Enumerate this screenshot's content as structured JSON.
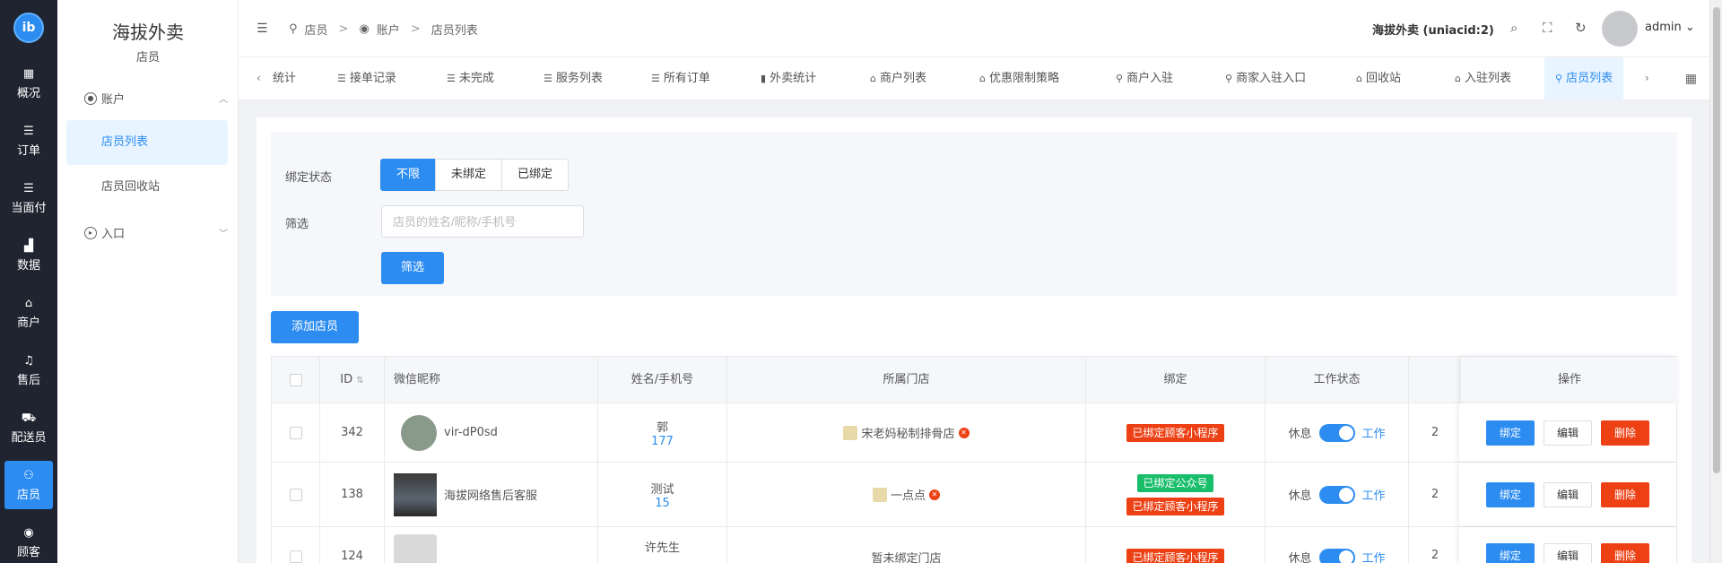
{
  "rail": {
    "logo": "ib",
    "items": [
      {
        "label": "概况",
        "icon": "dashboard-icon"
      },
      {
        "label": "订单",
        "icon": "list-icon"
      },
      {
        "label": "当面付",
        "icon": "list-icon"
      },
      {
        "label": "数据",
        "icon": "bar-chart-icon"
      },
      {
        "label": "商户",
        "icon": "store-icon"
      },
      {
        "label": "售后",
        "icon": "headset-icon"
      },
      {
        "label": "配送员",
        "icon": "scooter-icon"
      },
      {
        "label": "店员",
        "icon": "users-icon"
      },
      {
        "label": "顾客",
        "icon": "user-circle-icon"
      }
    ]
  },
  "sidebar": {
    "title": "海拔外卖",
    "subtitle": "店员",
    "group1": "账户",
    "items": [
      "店员列表",
      "店员回收站"
    ],
    "group2": "入口"
  },
  "header": {
    "breadcrumb": [
      "店员",
      "账户",
      "店员列表"
    ],
    "breadcrumb_sep": ">",
    "app_name": "海拔外卖 (uniacid:2)",
    "user": "admin"
  },
  "tabs": [
    {
      "label": "统计",
      "icon": ""
    },
    {
      "label": "接单记录",
      "icon": "☰"
    },
    {
      "label": "未完成",
      "icon": "☰"
    },
    {
      "label": "服务列表",
      "icon": "☰"
    },
    {
      "label": "所有订单",
      "icon": "☰"
    },
    {
      "label": "外卖统计",
      "icon": "▮"
    },
    {
      "label": "商户列表",
      "icon": "⌂"
    },
    {
      "label": "优惠限制策略",
      "icon": "⌂"
    },
    {
      "label": "商户入驻",
      "icon": "⚲"
    },
    {
      "label": "商家入驻入口",
      "icon": "⚲"
    },
    {
      "label": "回收站",
      "icon": "⌂"
    },
    {
      "label": "入驻列表",
      "icon": "⌂"
    },
    {
      "label": "店员列表",
      "icon": "⚲"
    }
  ],
  "filter": {
    "bind_label": "绑定状态",
    "bind_options": [
      "不限",
      "未绑定",
      "已绑定"
    ],
    "bind_selected": "不限",
    "search_label": "筛选",
    "search_placeholder": "店员的姓名/昵称/手机号",
    "search_button": "筛选"
  },
  "add_button": "添加店员",
  "table": {
    "columns": [
      "ID",
      "微信昵称",
      "姓名/手机号",
      "所属门店",
      "绑定",
      "工作状态",
      "操作"
    ],
    "rows": [
      {
        "id": "342",
        "nickname": "vir-dP0sd",
        "name": "郭",
        "phone": "177",
        "store": "宋老妈秘制排骨店",
        "tags": [
          "已绑定顾客小程序"
        ],
        "off": "休息",
        "on": "工作",
        "extra": "2"
      },
      {
        "id": "138",
        "nickname": "海拔网络售后客服",
        "name": "测试",
        "phone": "15",
        "store": "一点点",
        "tags": [
          "已绑定公众号",
          "已绑定顾客小程序"
        ],
        "off": "休息",
        "on": "工作",
        "extra": "2"
      },
      {
        "id": "124",
        "nickname": "",
        "name": "许先生",
        "phone": "",
        "store": "暂未绑定门店",
        "tags": [
          "已绑定顾客小程序"
        ],
        "off": "休息",
        "on": "工作",
        "extra": "2"
      }
    ],
    "actions": [
      "绑定",
      "编辑",
      "删除"
    ]
  },
  "colors": {
    "primary": "#2d8cf0",
    "danger": "#ed4014",
    "success": "#19be6b",
    "rail": "#1f2430"
  }
}
